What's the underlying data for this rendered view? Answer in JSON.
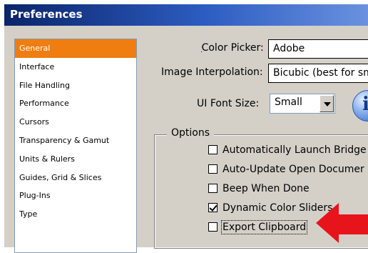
{
  "window": {
    "title": "Preferences"
  },
  "sidebar": {
    "items": [
      {
        "label": "General",
        "selected": true
      },
      {
        "label": "Interface"
      },
      {
        "label": "File Handling"
      },
      {
        "label": "Performance"
      },
      {
        "label": "Cursors"
      },
      {
        "label": "Transparency & Gamut"
      },
      {
        "label": "Units & Rulers"
      },
      {
        "label": "Guides, Grid & Slices"
      },
      {
        "label": "Plug-Ins"
      },
      {
        "label": "Type"
      }
    ]
  },
  "general": {
    "color_picker": {
      "label": "Color Picker:",
      "value": "Adobe"
    },
    "image_interpolation": {
      "label": "Image Interpolation:",
      "value": "Bicubic (best for sm"
    },
    "ui_font_size": {
      "label": "UI Font Size:",
      "value": "Small"
    },
    "options": {
      "legend": "Options",
      "items": [
        {
          "label": "Automatically Launch Bridge",
          "checked": false
        },
        {
          "label": "Auto-Update Open Documer",
          "checked": false
        },
        {
          "label": "Beep When Done",
          "checked": false
        },
        {
          "label": "Dynamic Color Sliders",
          "checked": true
        },
        {
          "label": "Export Clipboard",
          "checked": false
        }
      ]
    }
  },
  "icons": {
    "info": "info-icon",
    "annotation_arrow": "red-arrow-icon"
  },
  "colors": {
    "selected": "#f07d10",
    "titlebar": "#0a246a",
    "arrow": "#e8141c"
  }
}
